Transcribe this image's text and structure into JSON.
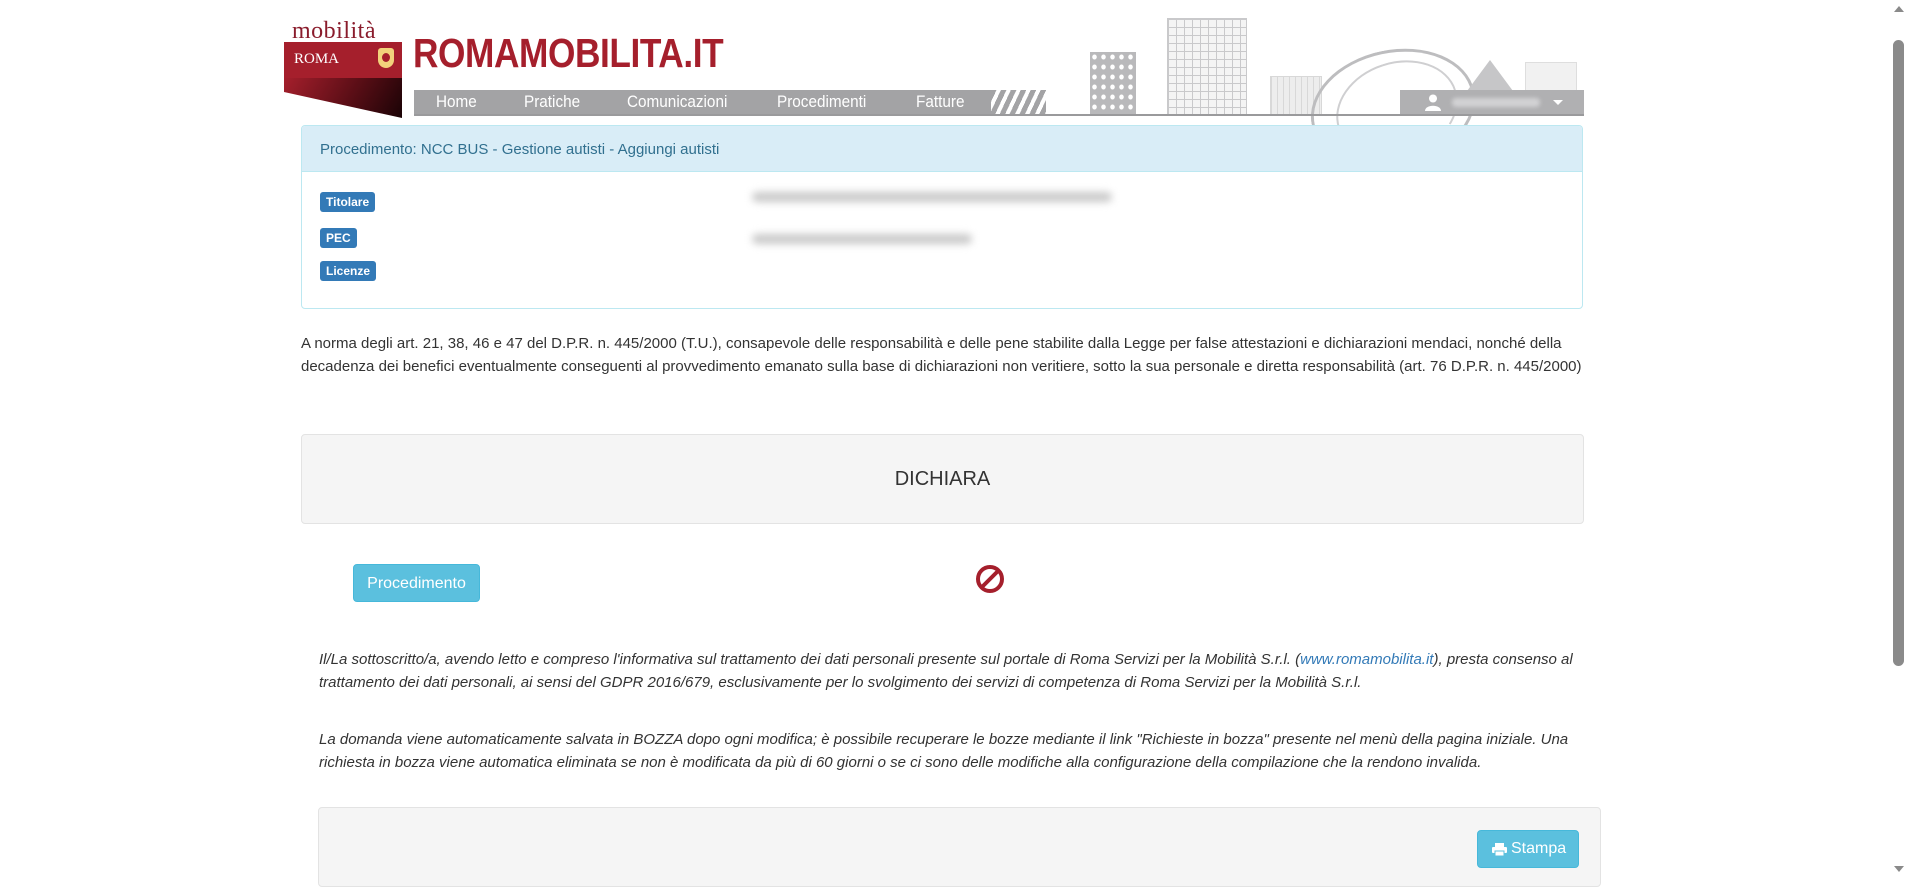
{
  "header": {
    "logo": {
      "top_text": "mobilità",
      "ribbon_text": "ROMA",
      "brand_title": "ROMAMOBILITA.IT"
    },
    "nav": [
      {
        "label": "Home"
      },
      {
        "label": "Pratiche"
      },
      {
        "label": "Comunicazioni"
      },
      {
        "label": "Procedimenti"
      },
      {
        "label": "Fatture"
      }
    ],
    "user_menu": {
      "icon": "user-icon",
      "caret": "caret-down-icon"
    }
  },
  "procedure": {
    "heading": "Procedimento: NCC BUS - Gestione autisti - Aggiungi autisti",
    "badges": {
      "titolare": "Titolare",
      "pec": "PEC",
      "licenze": "Licenze"
    }
  },
  "declaration": {
    "text": "A norma degli art. 21, 38, 46 e 47 del D.P.R. n. 445/2000 (T.U.), consapevole delle responsabilità e delle pene stabilite dalla Legge per false attestazioni e dichiarazioni mendaci, nonché della decadenza dei benefici eventualmente conseguenti al provvedimento emanato sulla base di dichiarazioni non veritiere, sotto la sua personale e diretta responsabilità (art. 76 D.P.R. n. 445/2000)",
    "dichiara_title": "DICHIARA"
  },
  "actions": {
    "procedimento_button": "Procedimento",
    "status_icon": "no-entry-icon",
    "print_button": "Stampa",
    "print_icon": "print-icon"
  },
  "consent": {
    "part1": "Il/La sottoscritto/a, avendo letto e compreso l'informativa sul trattamento dei dati personali presente sul portale di Roma Servizi per la Mobilità S.r.l. (",
    "link": "www.romamobilita.it",
    "part2": "), presta consenso al trattamento dei dati personali, ai sensi del GDPR 2016/679, esclusivamente per lo svolgimento dei servizi di competenza di Roma Servizi per la Mobilità S.r.l."
  },
  "draft_notice": "La domanda viene automaticamente salvata in BOZZA dopo ogni modifica; è possibile recuperare le bozze mediante il link \"Richieste in bozza\" presente nel menù della pagina iniziale. Una richiesta in bozza viene automatica eliminata se non è modificata da più di 60 giorni o se ci sono delle modifiche alla configurazione della compilazione che la rendono invalida.",
  "colors": {
    "brand": "#a51f2c",
    "nav_bg": "#a3a3a5",
    "info_panel": "#d9edf7",
    "badge": "#337ab7",
    "info_button": "#5bc0de",
    "no_entry": "#a51f2c"
  }
}
